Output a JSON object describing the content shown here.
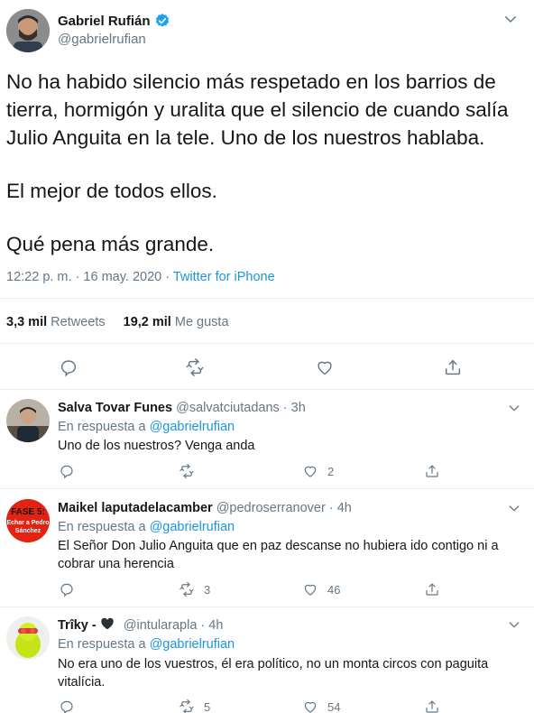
{
  "main_tweet": {
    "author_name": "Gabriel Rufián",
    "author_handle": "@gabrielrufian",
    "text_lines": [
      "No ha habido silencio más respetado en los barrios de",
      "tierra, hormigón y uralita que el silencio de cuando salía",
      "Julio Anguita en la tele. Uno de los nuestros hablaba.",
      "El mejor de todos ellos.",
      "Qué pena más grande."
    ],
    "time": "12:22 p. m. · 16 may. 2020 · ",
    "source": "Twitter for iPhone",
    "retweets_count": "3,3 mil",
    "retweets_label": "Retweets",
    "likes_count": "19,2 mil",
    "likes_label": "Me gusta"
  },
  "replies": [
    {
      "name": "Salva Tovar Funes",
      "handle": "@salvatciutadans · 3h",
      "reply_prefix": "En respuesta a ",
      "reply_link": "@gabrielrufian",
      "text": "Uno de los nuestros? Venga anda",
      "retweets": "",
      "likes": "2"
    },
    {
      "name": "Maikel laputadelacamber",
      "handle": "@pedroserranover · 4h",
      "reply_prefix": "En respuesta a ",
      "reply_link": "@gabrielrufian",
      "text": "El Señor Don Julio Anguita que en paz descanse no hubiera ido contigo ni a cobrar una herencia",
      "retweets": "3",
      "likes": "46",
      "avatar_lines": [
        "FASE 5:",
        "Echar a Pedro",
        "Sánchez"
      ]
    },
    {
      "name": "Trîky - ",
      "handle": "@intularapla · 4h",
      "reply_prefix": "En respuesta a ",
      "reply_link": "@gabrielrufian",
      "text": "No era uno de los vuestros, él era político, no un monta circos con paguita vitalícia.",
      "retweets": "5",
      "likes": "54"
    }
  ],
  "icons": [
    "verified-icon",
    "chevron-down-icon",
    "reply-icon",
    "retweet-icon",
    "like-icon",
    "share-icon",
    "heart-emoji-icon"
  ],
  "colors": {
    "link": "#1b95e0",
    "muted": "#657786",
    "text": "#14171a",
    "divider": "#e6ecf0"
  }
}
